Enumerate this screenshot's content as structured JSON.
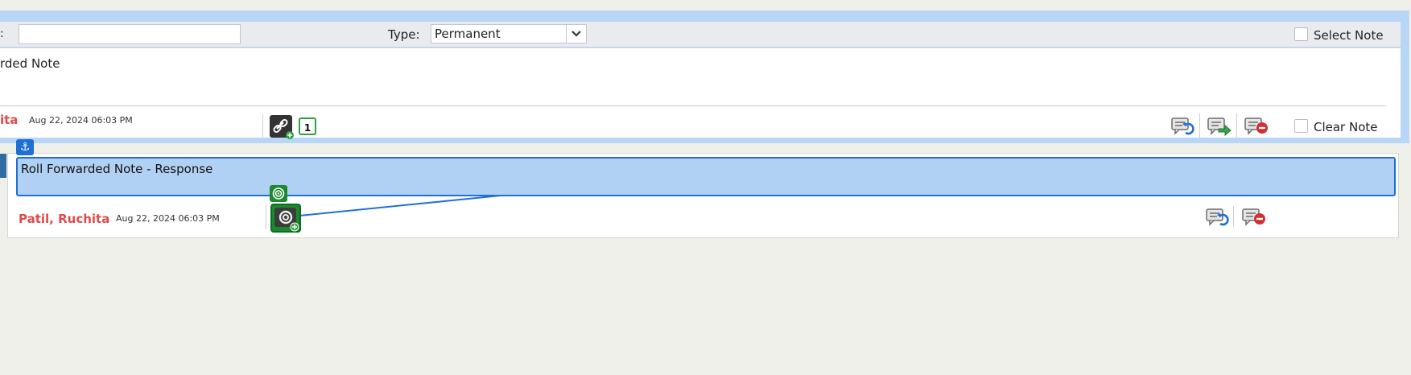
{
  "note1": {
    "title_label_fragment": ":",
    "title_value": "",
    "type_label": "Type:",
    "type_value": "Permanent",
    "select_note_label": "Select Note",
    "text": "rded Note",
    "author": "ita",
    "timestamp": "Aug 22, 2024 06:03 PM",
    "link_count": "1",
    "clear_note_label": "Clear Note"
  },
  "note2": {
    "text": "Roll Forwarded Note - Response",
    "author": "Patil, Ruchita",
    "timestamp": "Aug 22, 2024 06:03 PM"
  },
  "icons": {
    "anchor": "anchor-icon",
    "target": "target-icon",
    "link": "chain-link-icon",
    "reply": "reply-note-icon",
    "forward": "forward-note-icon",
    "delete": "delete-note-icon",
    "dropdown": "chevron-down-icon"
  },
  "colors": {
    "selection_frame": "#b8d7f7",
    "author_red": "#e04a4a",
    "highlight_blue": "#1f6fd6",
    "link_green": "#2ea040"
  }
}
